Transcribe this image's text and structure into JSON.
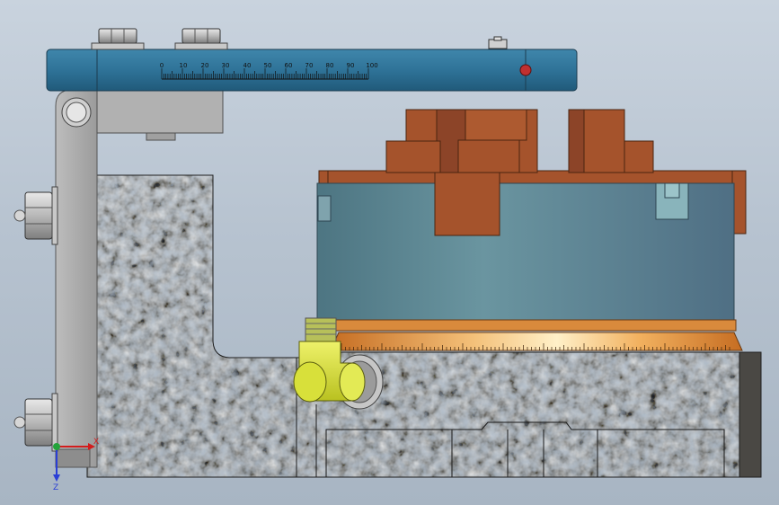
{
  "scale": {
    "labels": [
      "0",
      "10",
      "20",
      "30",
      "40",
      "50",
      "60",
      "70",
      "80",
      "90",
      "100"
    ]
  },
  "triad": {
    "x_label": "X",
    "z_label": "Z"
  },
  "colors": {
    "background": "#b7c3d0",
    "scale_bar": "#2d6f93",
    "bracket": "#a8a8a8",
    "granite": "#3a3936",
    "chuck": "#5f8595",
    "jaws": "#a5532c",
    "ring": "#d98a3c",
    "fitting": "#d8e03a",
    "indicator": "#c03030"
  },
  "icons": [
    "hex-nut-icon",
    "pivot-pin-icon",
    "indicator-dot-icon",
    "axis-triad-icon"
  ]
}
